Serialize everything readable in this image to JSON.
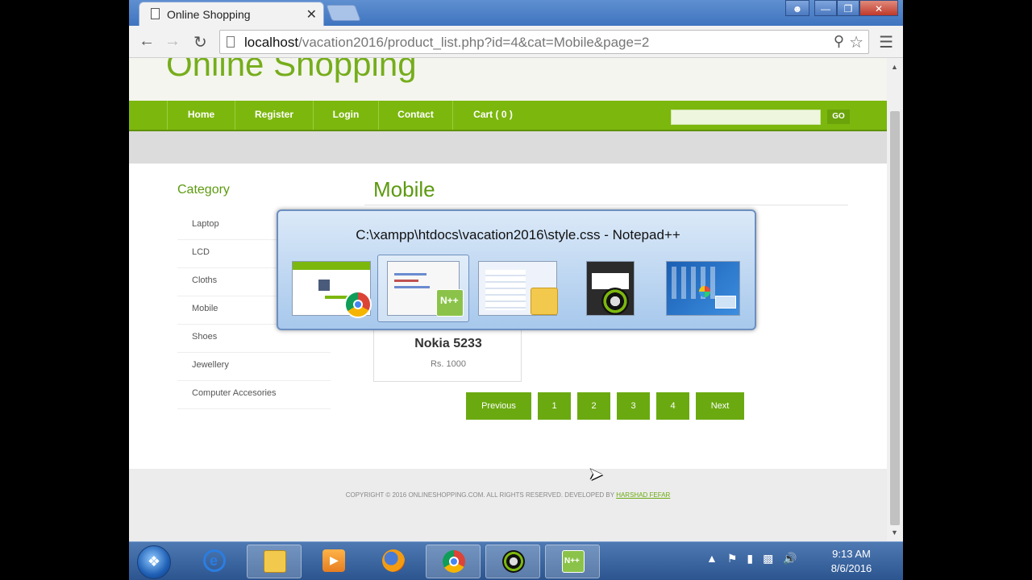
{
  "browser": {
    "tab_title": "Online Shopping",
    "tab_close": "✕",
    "url_host": "localhost",
    "url_path": "/vacation2016/product_list.php?id=4&cat=Mobile&page=2"
  },
  "site": {
    "title": "Online Shopping",
    "nav": [
      "Home",
      "Register",
      "Login",
      "Contact",
      "Cart ( 0 )"
    ],
    "search_placeholder": "",
    "go_label": "GO"
  },
  "sidebar": {
    "title": "Category",
    "items": [
      "Laptop",
      "LCD",
      "Cloths",
      "Mobile",
      "Shoes",
      "Jewellery",
      "Computer Accesories"
    ]
  },
  "main": {
    "heading": "Mobile",
    "product": {
      "name": "Nokia 5233",
      "price": "Rs. 1000"
    },
    "pagination": [
      "Previous",
      "1",
      "2",
      "3",
      "4",
      "Next"
    ]
  },
  "footer": {
    "text": "COPYRIGHT © 2016 ONLINESHOPPING.COM. ALL RIGHTS RESERVED. DEVELOPED BY",
    "author": "HARSHAD FEFAR"
  },
  "switcher": {
    "title": "C:\\xampp\\htdocs\\vacation2016\\style.css - Notepad++"
  },
  "taskbar": {
    "time": "9:13 AM",
    "date": "8/6/2016"
  },
  "icons": {
    "start": "windows-start-icon",
    "ie": "internet-explorer-icon",
    "explorer": "folder-icon",
    "media": "media-player-icon",
    "firefox": "firefox-icon",
    "chrome": "chrome-icon",
    "camstudio": "camera-icon",
    "notepadpp": "notepad-plus-plus-icon"
  },
  "colors": {
    "accent": "#7cb70e",
    "heading": "#5c9a10",
    "taskbar": "#2c5590"
  }
}
